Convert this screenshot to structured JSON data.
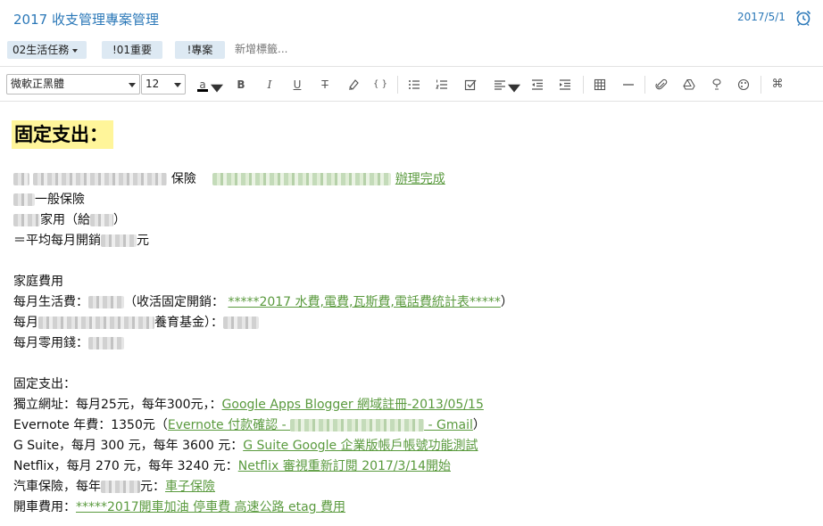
{
  "header": {
    "title": "2017 收支管理專案管理",
    "date": "2017/5/1",
    "alarm_icon": "alarm-clock-icon"
  },
  "tags": {
    "items": [
      "02生活任務",
      "!01重要",
      "!專案"
    ],
    "new_tag_placeholder": "新增標籤..."
  },
  "toolbar": {
    "font_family": "微軟正黑體",
    "font_size": "12",
    "color_label": "a",
    "bold": "B",
    "italic": "I",
    "underline": "U",
    "strike": "T",
    "code": "{ }",
    "more": "⌘"
  },
  "content": {
    "heading": "固定支出：",
    "lines": {
      "insurance_label": "保險",
      "insurance_link": "辦理完成",
      "general_insurance": "一般保險",
      "family_prefix": "家用（給",
      "family_suffix": "）",
      "avg_prefix": "＝平均每月開銷",
      "avg_suffix": "元",
      "family_expense": "家庭費用",
      "living_prefix": "每月生活費：",
      "living_mid": "（收活固定開銷：",
      "living_link": "*****2017 水費,電費,瓦斯費,電話費統計表*****",
      "living_suffix": "）",
      "monthly_prefix": "每月",
      "monthly_mid": "養育基金）：",
      "pocket_money": "每月零用錢：",
      "fixed_expense": "固定支出：",
      "website_prefix": "獨立網址：每月25元，每年300元，：",
      "website_link": "Google Apps Blogger 網域註冊-2013/05/15",
      "evernote_prefix": "Evernote 年費：1350元（",
      "evernote_link_a": "Evernote 付款確認 - ",
      "evernote_link_b": " - Gmail",
      "evernote_suffix": "）",
      "gsuite_prefix": "G Suite，每月 300 元，每年 3600 元：",
      "gsuite_link": "G Suite Google 企業版帳戶帳號功能測試",
      "netflix_prefix": "Netflix，每月 270 元，每年 3240 元：",
      "netflix_link": "Netflix 審視重新訂閱 2017/3/14開始",
      "car_prefix": "汽車保險，每年",
      "car_mid": "元：",
      "car_link": "車子保險",
      "drive_prefix": "開車費用：",
      "drive_link": "*****2017開車加油 停車費 高速公路 etag 費用"
    }
  }
}
